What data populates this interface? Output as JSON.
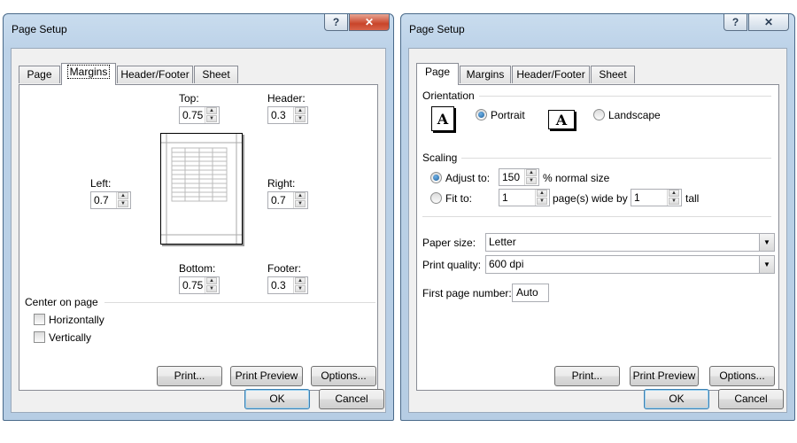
{
  "left_dialog": {
    "title": "Page Setup",
    "help_glyph": "?",
    "close_glyph": "✕",
    "tabs": [
      {
        "label": "Page",
        "active": false
      },
      {
        "label": "Margins",
        "active": true
      },
      {
        "label": "Header/Footer",
        "active": false
      },
      {
        "label": "Sheet",
        "active": false
      }
    ],
    "margins": {
      "top_label": "Top:",
      "top_value": "0.75",
      "header_label": "Header:",
      "header_value": "0.3",
      "left_label": "Left:",
      "left_value": "0.7",
      "right_label": "Right:",
      "right_value": "0.7",
      "bottom_label": "Bottom:",
      "bottom_value": "0.75",
      "footer_label": "Footer:",
      "footer_value": "0.3"
    },
    "center_on_page": {
      "label": "Center on page",
      "horizontally_label": "Horizontally",
      "vertically_label": "Vertically",
      "horizontally_checked": false,
      "vertically_checked": false
    },
    "buttons": {
      "print": "Print...",
      "print_preview": "Print Preview",
      "options": "Options...",
      "ok": "OK",
      "cancel": "Cancel"
    }
  },
  "right_dialog": {
    "title": "Page Setup",
    "help_glyph": "?",
    "close_glyph": "✕",
    "tabs": [
      {
        "label": "Page",
        "active": true
      },
      {
        "label": "Margins",
        "active": false
      },
      {
        "label": "Header/Footer",
        "active": false
      },
      {
        "label": "Sheet",
        "active": false
      }
    ],
    "orientation": {
      "label": "Orientation",
      "portrait": "Portrait",
      "landscape": "Landscape",
      "selected": "portrait",
      "glyph_letter": "A"
    },
    "scaling": {
      "label": "Scaling",
      "adjust_to": "Adjust to:",
      "adjust_value": "150",
      "normal_size": "% normal size",
      "fit_to": "Fit to:",
      "fit_wide_value": "1",
      "pages_wide_by": "page(s) wide by",
      "fit_tall_value": "1",
      "tall": "tall",
      "selected": "adjust"
    },
    "paper_size_label": "Paper size:",
    "paper_size_value": "Letter",
    "print_quality_label": "Print quality:",
    "print_quality_value": "600 dpi",
    "first_page_label": "First page number:",
    "first_page_value": "Auto",
    "buttons": {
      "print": "Print...",
      "print_preview": "Print Preview",
      "options": "Options...",
      "ok": "OK",
      "cancel": "Cancel"
    }
  },
  "colors": {
    "title_bar": "#bcd2e8",
    "close_red": "#c9452a",
    "panel": "#ffffff",
    "client": "#f0f0f0"
  }
}
